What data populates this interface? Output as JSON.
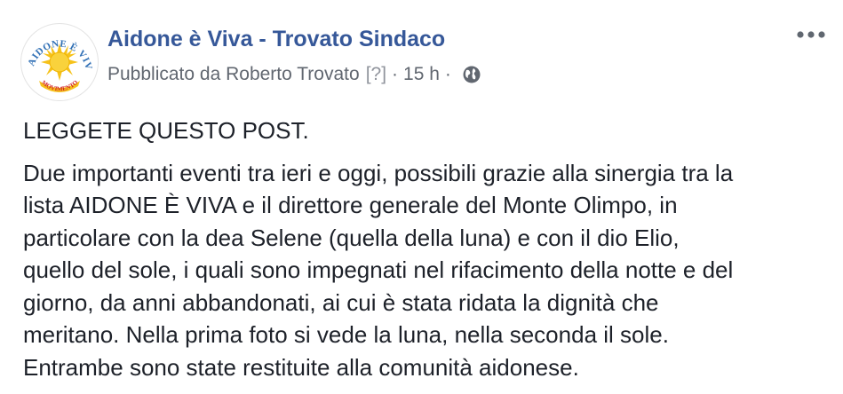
{
  "post": {
    "page_name": "Aidone è Viva - Trovato Sindaco",
    "meta": {
      "published_by": "Pubblicato da Roberto Trovato",
      "help": "[?]",
      "separator": "·",
      "time": "15 h",
      "privacy_icon": "globe-icon"
    },
    "avatar": {
      "text_top": "AIDONE È VIVA",
      "text_bottom": "MOVIMENTO",
      "colors": {
        "sun": "#f6c21a",
        "text_blue": "#2f6fb5",
        "text_red": "#d2232a"
      }
    },
    "more_icon": "more-options-icon",
    "headline": "LEGGETE QUESTO POST.",
    "body_lines": [
      "Due importanti eventi tra ieri e oggi, possibili grazie alla sinergia tra la",
      "lista AIDONE È VIVA e il direttore generale del Monte Olimpo, in",
      "particolare con la dea Selene (quella della luna) e con il dio Elio,",
      "quello del sole, i quali sono impegnati nel rifacimento della notte e del",
      "giorno, da anni abbandonati, ai cui è stata ridata la dignità che",
      "meritano. Nella prima foto si vede la luna, nella seconda il sole.",
      "Entrambe sono state restituite alla comunità aidonese."
    ]
  },
  "colors": {
    "link_blue": "#365899",
    "meta_gray": "#616770",
    "text": "#1d2129"
  }
}
